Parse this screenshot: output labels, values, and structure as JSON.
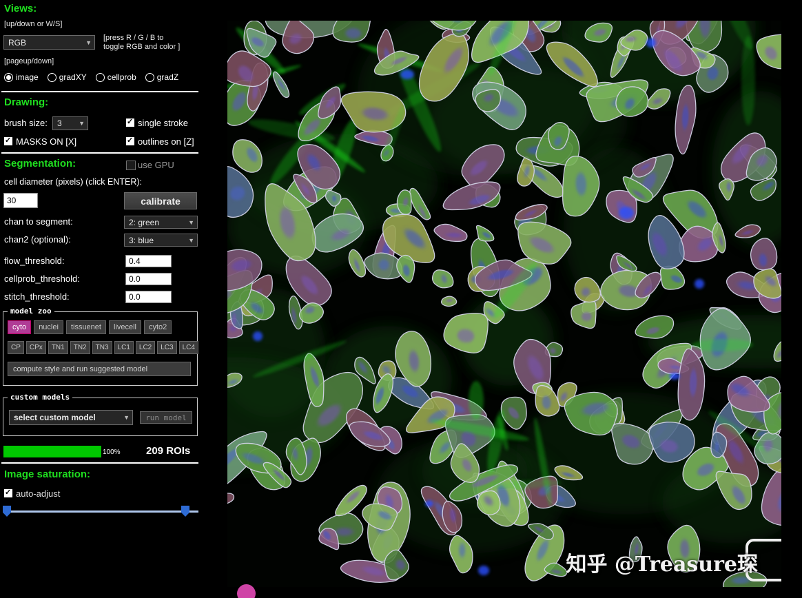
{
  "sidebar": {
    "views": {
      "title": "Views:",
      "updown_hint": "[up/down or W/S]",
      "view_mode": "RGB",
      "rgb_hint": "[press R / G / B to\ntoggle RGB and color ]",
      "page_hint": "[pageup/down]",
      "radio_image": "image",
      "radio_gradxy": "gradXY",
      "radio_cellprob": "cellprob",
      "radio_gradz": "gradZ"
    },
    "drawing": {
      "title": "Drawing:",
      "brush_label": "brush size:",
      "brush_size": "3",
      "single_stroke": "single stroke",
      "masks_on": "MASKS ON [X]",
      "outlines_on": "outlines on [Z]"
    },
    "segmentation": {
      "title": "Segmentation:",
      "use_gpu": "use GPU",
      "diameter_label": "cell diameter (pixels) (click ENTER):",
      "diameter": "30",
      "calibrate": "calibrate",
      "chan_label": "chan to segment:",
      "chan": "2: green",
      "chan2_label": "chan2 (optional):",
      "chan2": "3: blue",
      "flow_label": "flow_threshold:",
      "flow": "0.4",
      "cellprob_label": "cellprob_threshold:",
      "cellprob": "0.0",
      "stitch_label": "stitch_threshold:",
      "stitch": "0.0"
    },
    "model_zoo": {
      "title": "model zoo",
      "selected_model": "cyto",
      "models": [
        "cyto",
        "nuclei",
        "tissuenet",
        "livecell",
        "cyto2"
      ],
      "models2": [
        "CP",
        "CPx",
        "TN1",
        "TN2",
        "TN3",
        "LC1",
        "LC2",
        "LC3",
        "LC4"
      ],
      "suggest": "compute style and run suggested model"
    },
    "custom": {
      "title": "custom models",
      "select": "select custom model",
      "run": "run model"
    },
    "progress": {
      "percent": "100%",
      "rois": "209 ROIs"
    },
    "saturation": {
      "title": "Image saturation:",
      "auto_adjust": "auto-adjust"
    }
  },
  "viewer": {
    "watermark": "知乎 @Treasure琛"
  },
  "colors": {
    "accent_green": "#1fdd1f",
    "progress_green": "#00c800",
    "model_active": "#b03c96",
    "slider_blue": "#2e6bd4"
  }
}
